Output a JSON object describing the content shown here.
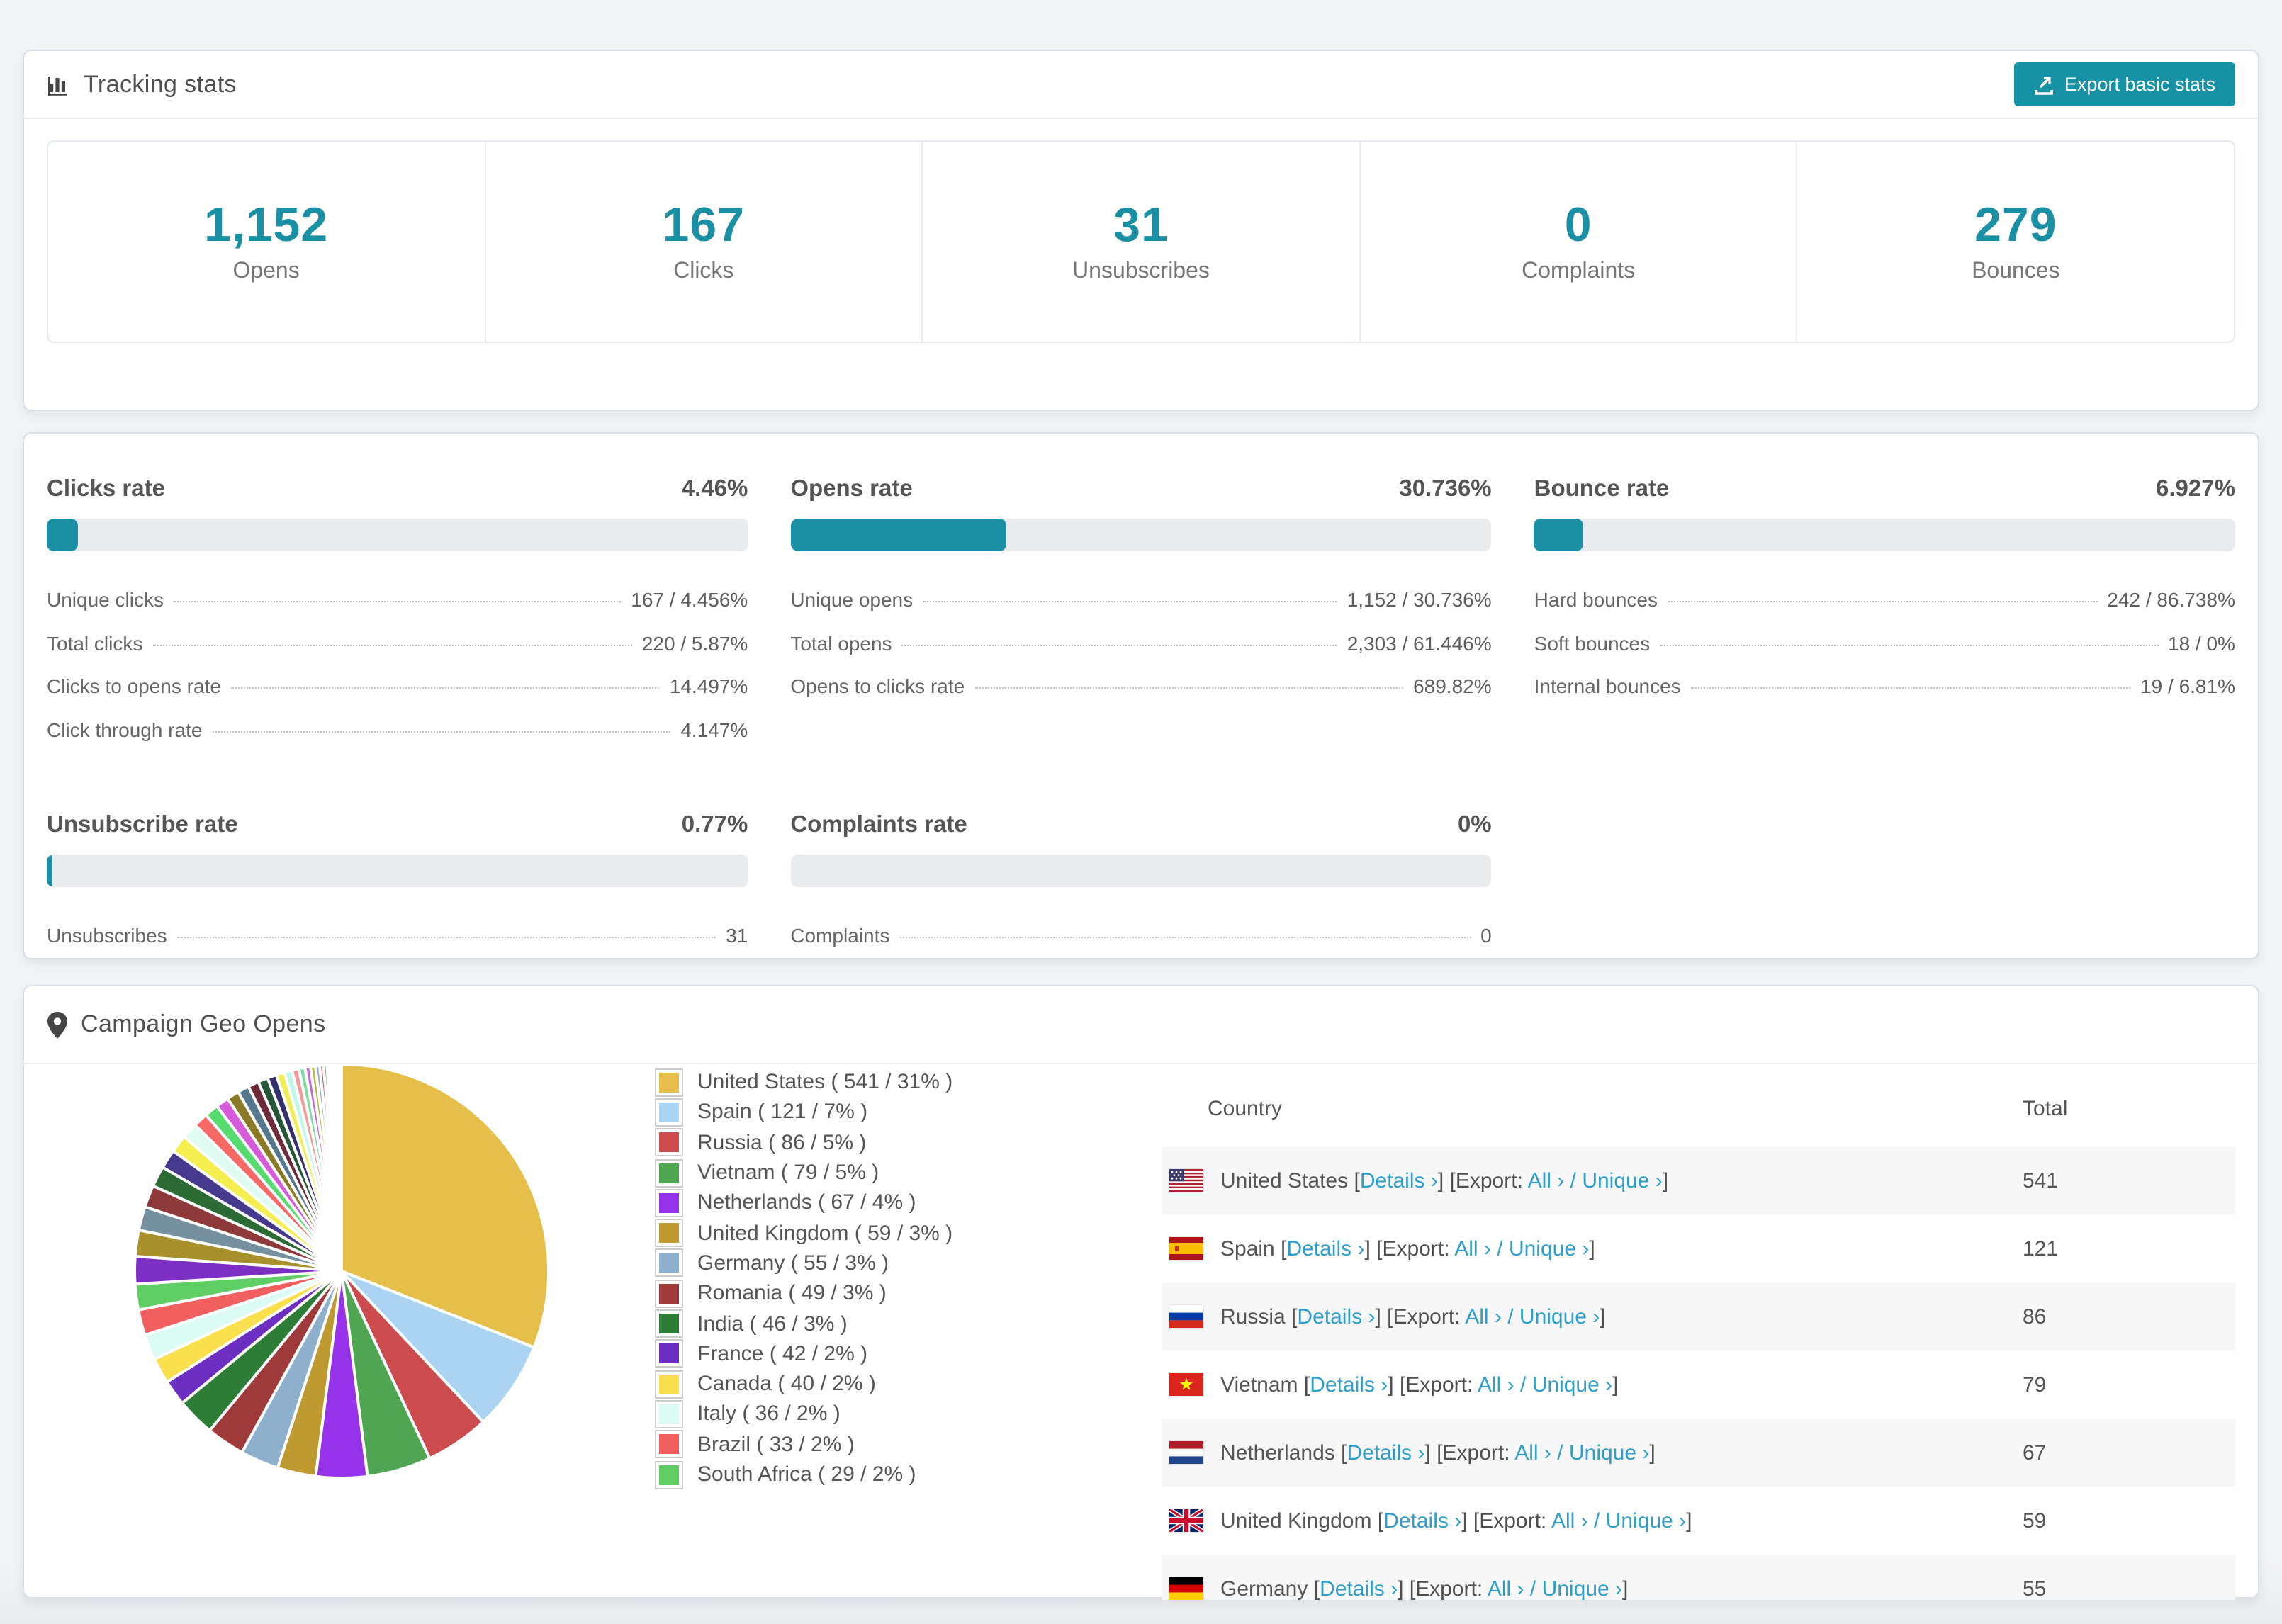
{
  "theme": {
    "accent": "#1B8FA3",
    "button": "#1792A4",
    "link": "#2E9FCC",
    "stripe": "#F7F7F8"
  },
  "tracking_stats": {
    "title": "Tracking stats",
    "export_button": "Export basic stats",
    "boxes": [
      {
        "value": "1,152",
        "label": "Opens"
      },
      {
        "value": "167",
        "label": "Clicks"
      },
      {
        "value": "31",
        "label": "Unsubscribes"
      },
      {
        "value": "0",
        "label": "Complaints"
      },
      {
        "value": "279",
        "label": "Bounces"
      }
    ]
  },
  "rates": {
    "panels": [
      {
        "id": "clicks",
        "title": "Clicks rate",
        "value": "4.46%",
        "percent": 4.46,
        "rows": [
          [
            "Unique clicks",
            "167 / 4.456%"
          ],
          [
            "Total clicks",
            "220 / 5.87%"
          ],
          [
            "Clicks to opens rate",
            "14.497%"
          ],
          [
            "Click through rate",
            "4.147%"
          ]
        ]
      },
      {
        "id": "opens",
        "title": "Opens rate",
        "value": "30.736%",
        "percent": 30.736,
        "rows": [
          [
            "Unique opens",
            "1,152 / 30.736%"
          ],
          [
            "Total opens",
            "2,303 / 61.446%"
          ],
          [
            "Opens to clicks rate",
            "689.82%"
          ]
        ]
      },
      {
        "id": "bounce",
        "title": "Bounce rate",
        "value": "6.927%",
        "percent": 6.927,
        "rows": [
          [
            "Hard bounces",
            "242 / 86.738%"
          ],
          [
            "Soft bounces",
            "18 / 0%"
          ],
          [
            "Internal bounces",
            "19 / 6.81%"
          ]
        ]
      },
      {
        "id": "unsubscribe",
        "title": "Unsubscribe rate",
        "value": "0.77%",
        "percent": 0.77,
        "rows": [
          [
            "Unsubscribes",
            "31"
          ]
        ]
      },
      {
        "id": "complaints",
        "title": "Complaints rate",
        "value": "0%",
        "percent": 0,
        "rows": [
          [
            "Complaints",
            "0"
          ]
        ]
      }
    ]
  },
  "geo": {
    "title": "Campaign Geo Opens",
    "chart_data": {
      "type": "pie",
      "title": "Campaign Geo Opens",
      "slices": [
        {
          "name": "United States",
          "count": 541,
          "pct": 31,
          "color": "#E5BF4A"
        },
        {
          "name": "Spain",
          "count": 121,
          "pct": 7,
          "color": "#AAD4F2"
        },
        {
          "name": "Russia",
          "count": 86,
          "pct": 5,
          "color": "#CB4B4F"
        },
        {
          "name": "Vietnam",
          "count": 79,
          "pct": 5,
          "color": "#4FA552"
        },
        {
          "name": "Netherlands",
          "count": 67,
          "pct": 4,
          "color": "#9632EA"
        },
        {
          "name": "United Kingdom",
          "count": 59,
          "pct": 3,
          "color": "#BE9A30"
        },
        {
          "name": "Germany",
          "count": 55,
          "pct": 3,
          "color": "#8FB0CC"
        },
        {
          "name": "Romania",
          "count": 49,
          "pct": 3,
          "color": "#9E3A3A"
        },
        {
          "name": "India",
          "count": 46,
          "pct": 3,
          "color": "#2E7D36"
        },
        {
          "name": "France",
          "count": 42,
          "pct": 2,
          "color": "#6D2EC2"
        },
        {
          "name": "Canada",
          "count": 40,
          "pct": 2,
          "color": "#FBE04D"
        },
        {
          "name": "Italy",
          "count": 36,
          "pct": 2,
          "color": "#DBFCF4"
        },
        {
          "name": "Brazil",
          "count": 33,
          "pct": 2,
          "color": "#F25F5F"
        },
        {
          "name": "South Africa",
          "count": 29,
          "pct": 2,
          "color": "#5FCE64"
        }
      ],
      "others": {
        "note": "unlabeled long tail of smaller countries",
        "values": [
          1.8,
          1.7,
          1.55,
          1.45,
          1.35,
          1.25,
          1.15,
          1.05,
          0.95,
          0.9,
          0.85,
          0.8,
          0.75,
          0.7,
          0.65,
          0.6,
          0.55,
          0.5,
          0.45,
          0.4,
          0.36,
          0.32,
          0.28,
          0.25,
          0.22,
          0.19,
          0.16,
          0.13,
          0.11,
          0.09,
          0.07,
          0.06,
          0.05,
          0.04,
          0.03,
          0.02
        ],
        "colors": [
          "#7B2FC4",
          "#A8902C",
          "#75909E",
          "#8E3A3A",
          "#2C6B34",
          "#453A8E",
          "#F5EE4F",
          "#DFFCF2",
          "#F56A66",
          "#55DB6E",
          "#D55BDB",
          "#8A7A26",
          "#55788F",
          "#6E2A38",
          "#275538",
          "#35306E",
          "#EFEF55",
          "#BFF7E8",
          "#F59A96",
          "#7FDB9E",
          "#C467DB",
          "#B8B83C",
          "#8FA8BF",
          "#A85050",
          "#3A8E4A",
          "#6655B8",
          "#F7F7A8",
          "#DFFFFA",
          "#FFC4C4",
          "#A8EFC4",
          "#E8A8F2",
          "#D4D4D4",
          "#BFD4E8",
          "#E8BFBF",
          "#C4E8C4",
          "#D8C4F2"
        ]
      }
    },
    "legend": [
      {
        "label": "United States ( 541 / 31% )",
        "color": "#E5BF4A"
      },
      {
        "label": "Spain ( 121 / 7% )",
        "color": "#AAD4F2"
      },
      {
        "label": "Russia ( 86 / 5% )",
        "color": "#CB4B4F"
      },
      {
        "label": "Vietnam ( 79 / 5% )",
        "color": "#4FA552"
      },
      {
        "label": "Netherlands ( 67 / 4% )",
        "color": "#9632EA"
      },
      {
        "label": "United Kingdom ( 59 / 3% )",
        "color": "#BE9A30"
      },
      {
        "label": "Germany ( 55 / 3% )",
        "color": "#8FB0CC"
      },
      {
        "label": "Romania ( 49 / 3% )",
        "color": "#9E3A3A"
      },
      {
        "label": "India ( 46 / 3% )",
        "color": "#2E7D36"
      },
      {
        "label": "France ( 42 / 2% )",
        "color": "#6D2EC2"
      },
      {
        "label": "Canada ( 40 / 2% )",
        "color": "#FBE04D"
      },
      {
        "label": "Italy ( 36 / 2% )",
        "color": "#DBFCF4"
      },
      {
        "label": "Brazil ( 33 / 2% )",
        "color": "#F25F5F"
      },
      {
        "label": "South Africa ( 29 / 2% )",
        "color": "#5FCE64"
      }
    ],
    "table": {
      "headers": [
        "Country",
        "Total"
      ],
      "links": {
        "details": "Details ›",
        "export_prefix": "[Export:",
        "all": "All ›",
        "slash": "/",
        "unique": "Unique ›"
      },
      "rows": [
        {
          "country": "United States",
          "flag": "us",
          "total": "541"
        },
        {
          "country": "Spain",
          "flag": "es",
          "total": "121"
        },
        {
          "country": "Russia",
          "flag": "ru",
          "total": "86"
        },
        {
          "country": "Vietnam",
          "flag": "vn",
          "total": "79"
        },
        {
          "country": "Netherlands",
          "flag": "nl",
          "total": "67"
        },
        {
          "country": "United Kingdom",
          "flag": "gb",
          "total": "59"
        },
        {
          "country": "Germany",
          "flag": "de",
          "total": "55"
        }
      ]
    }
  }
}
